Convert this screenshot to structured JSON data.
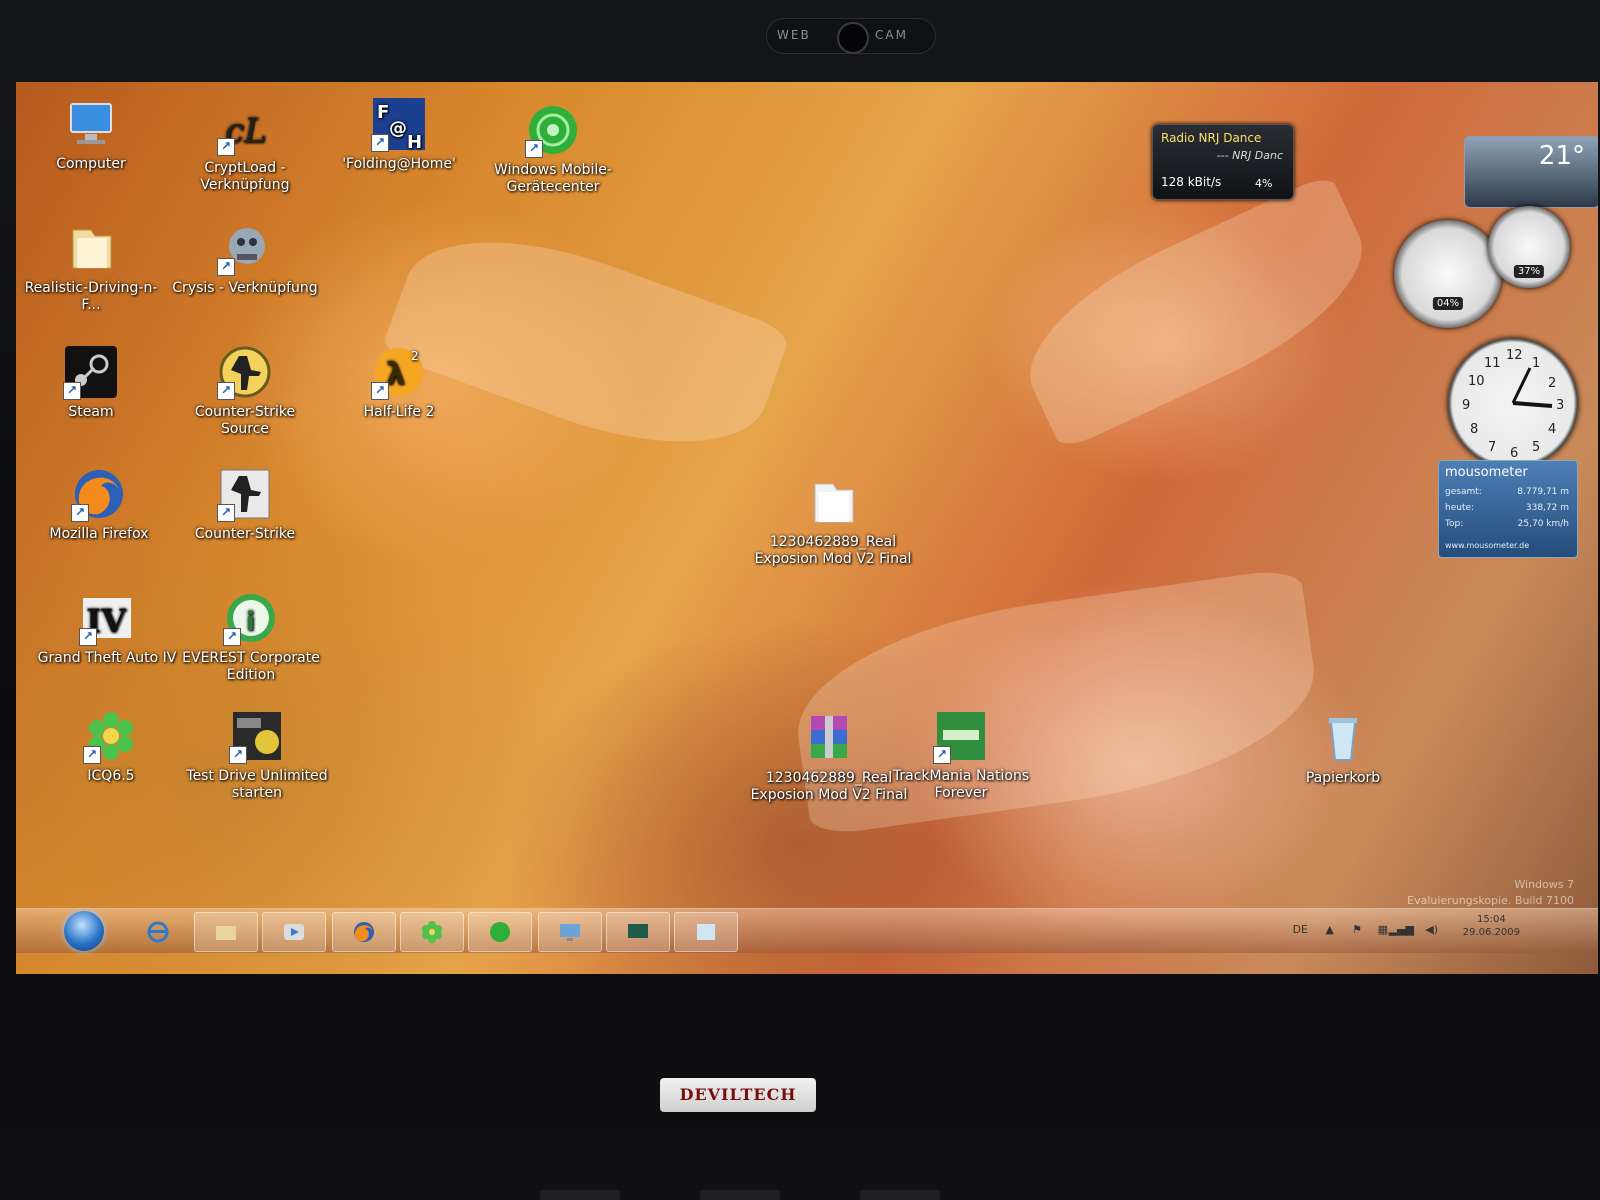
{
  "laptop": {
    "webcam_left": "WEB",
    "webcam_right": "CAM",
    "brand": "DEVILTECH"
  },
  "desktop_icons": [
    {
      "label": "Computer",
      "icon": "computer-icon"
    },
    {
      "label": "CryptLoad - Verknüpfung",
      "icon": "cryptload-icon"
    },
    {
      "label": "'Folding@Home'",
      "icon": "folding-at-home-icon"
    },
    {
      "label": "Windows Mobile-Gerätecenter",
      "icon": "windows-mobile-icon"
    },
    {
      "label": "Realistic-Driving-n-F...",
      "icon": "folder-icon"
    },
    {
      "label": "Crysis - Verknüpfung",
      "icon": "crysis-icon"
    },
    {
      "label": "Steam",
      "icon": "steam-icon"
    },
    {
      "label": "Counter-Strike Source",
      "icon": "counter-strike-source-icon"
    },
    {
      "label": "Half-Life 2",
      "icon": "half-life-2-icon"
    },
    {
      "label": "Mozilla Firefox",
      "icon": "firefox-icon"
    },
    {
      "label": "Counter-Strike",
      "icon": "counter-strike-icon"
    },
    {
      "label": "1230462889_Real Exposion Mod V2 Final",
      "icon": "folder-icon"
    },
    {
      "label": "Grand Theft Auto IV",
      "icon": "gta-iv-icon"
    },
    {
      "label": "EVEREST Corporate Edition",
      "icon": "everest-icon"
    },
    {
      "label": "ICQ6.5",
      "icon": "icq-icon"
    },
    {
      "label": "Test Drive Unlimited starten",
      "icon": "test-drive-icon"
    },
    {
      "label": "1230462889_Real Exposion Mod V2 Final",
      "icon": "winrar-icon"
    },
    {
      "label": "TrackMania Nations Forever",
      "icon": "trackmania-icon"
    },
    {
      "label": "Papierkorb",
      "icon": "recycle-bin-icon"
    }
  ],
  "gadgets": {
    "radio": {
      "title": "Radio NRJ Dance",
      "station": "--- NRJ Danc",
      "bitrate": "128 kBit/s",
      "volume": "4%"
    },
    "weather": {
      "temp": "21°"
    },
    "cpu_meter": {
      "cpu": "04%",
      "ram": "37%"
    },
    "clock": {
      "numbers": [
        "12",
        "1",
        "2",
        "3",
        "4",
        "5",
        "6",
        "7",
        "8",
        "9",
        "10",
        "11"
      ]
    },
    "mousometer": {
      "title": "mousometer",
      "rows": [
        {
          "label": "gesamt:",
          "value": "8.779,71 m"
        },
        {
          "label": "heute:",
          "value": "338,72 m"
        },
        {
          "label": "Top:",
          "value": "25,70 km/h"
        }
      ],
      "footer": "www.mousometer.de"
    }
  },
  "watermark": {
    "line1": "Windows 7",
    "line2": "Evaluierungskopie. Build 7100"
  },
  "taskbar": {
    "items": [
      "start-orb",
      "internet-explorer",
      "explorer",
      "media-player",
      "firefox",
      "icq",
      "windows-mobile",
      "remote-desktop",
      "monitor",
      "paint"
    ],
    "tray": {
      "lang": "DE",
      "time": "15:04",
      "date": "29.06.2009"
    }
  },
  "colors": {
    "taskbar": "#c98a5a",
    "accent": "#2a73c6"
  }
}
